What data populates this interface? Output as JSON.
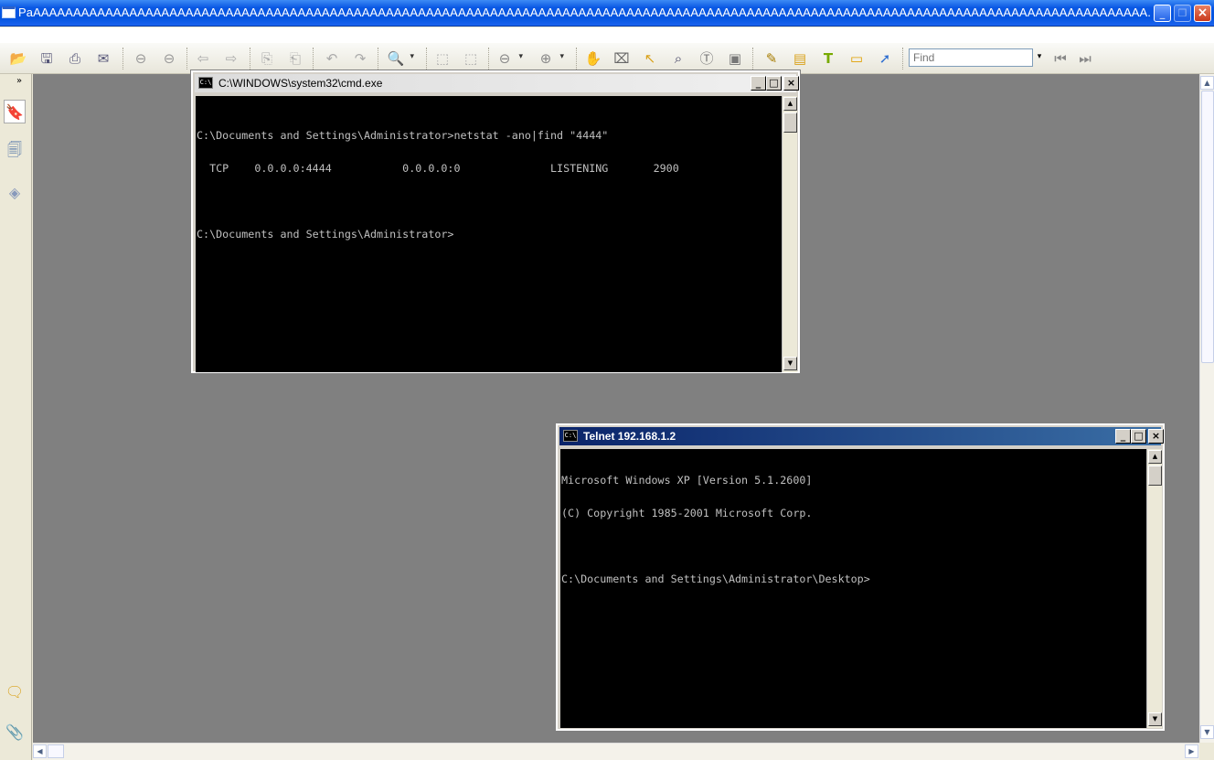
{
  "app": {
    "title": "PaAAAAAAAAAAAAAAAAAAAAAAAAAAAAAAAAAAAAAAAAAAAAAAAAAAAAAAAAAAAAAAAAAAAAAAAAAAAAAAAAAAAAAAAAAAAAAAAAAAAAAAAAAAAAAAAAAAAAAAAAAAAAAAAAAAAAAAAAAAA..."
  },
  "toolbar": {
    "find_placeholder": "Find",
    "icons": [
      "open-icon",
      "save-icon",
      "print-icon",
      "email-icon",
      "page-up-icon",
      "page-down-icon",
      "back-icon",
      "forward-icon",
      "extract-pages-icon",
      "insert-pages-icon",
      "undo-icon",
      "redo-icon",
      "zoom-icon",
      "fit-page-icon",
      "fit-width-icon",
      "zoom-out-icon",
      "zoom-in-icon",
      "hand-tool-icon",
      "snapshot-icon",
      "select-tool-icon",
      "find-binoculars-icon",
      "select-text-icon",
      "snapshot-camera-icon",
      "pencil-icon",
      "note-icon",
      "textbox-icon",
      "comment-icon",
      "arrow-icon"
    ]
  },
  "sidebar": {
    "items": [
      "bookmarks-icon",
      "pages-icon",
      "layers-icon"
    ],
    "bottom_items": [
      "comments-icon",
      "attachments-icon"
    ]
  },
  "cmd_window": {
    "title": "C:\\WINDOWS\\system32\\cmd.exe",
    "icon_text": "C:\\",
    "lines": [
      "C:\\Documents and Settings\\Administrator>netstat -ano|find \"4444\"",
      "  TCP    0.0.0.0:4444           0.0.0.0:0              LISTENING       2900",
      "",
      "C:\\Documents and Settings\\Administrator>"
    ]
  },
  "telnet_window": {
    "title": "Telnet 192.168.1.2",
    "icon_text": "C:\\",
    "lines": [
      "Microsoft Windows XP [Version 5.1.2600]",
      "(C) Copyright 1985-2001 Microsoft Corp.",
      "",
      "C:\\Documents and Settings\\Administrator\\Desktop>"
    ]
  },
  "window_buttons": {
    "minimize": "_",
    "maximize": "□",
    "close": "×",
    "restore": "❐"
  },
  "colors": {
    "workspace": "#808080",
    "title_bar": "#0454e0",
    "console_bg": "#000000",
    "console_text": "#c0c0c0",
    "active_caption": "#0a246a"
  }
}
